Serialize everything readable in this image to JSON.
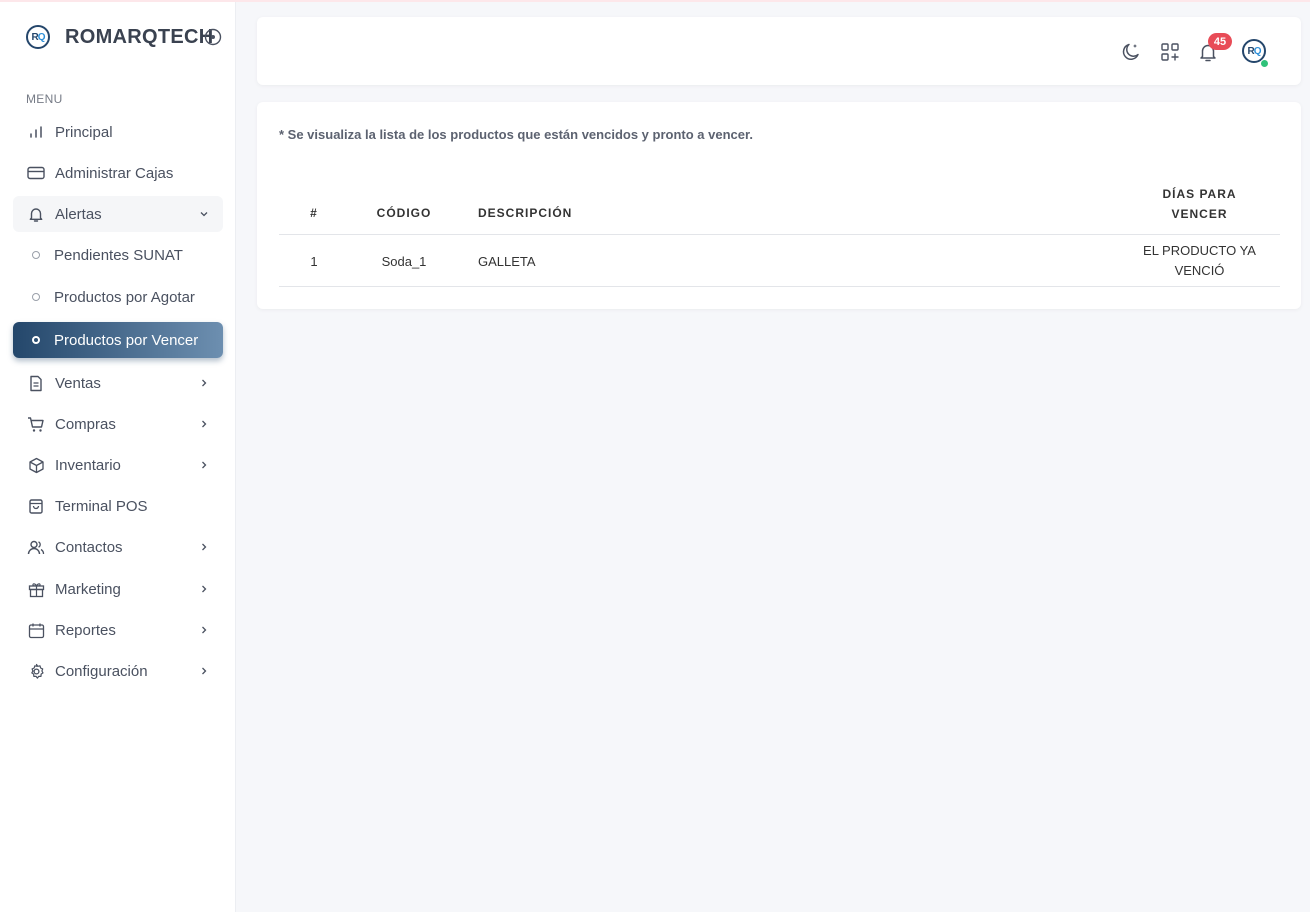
{
  "brand": {
    "name": "ROMARQTECH",
    "logo_letters": [
      "R",
      "Q"
    ]
  },
  "sidebar": {
    "menu_label": "MENU",
    "items": [
      {
        "label": "Principal",
        "icon": "bar-chart-icon"
      },
      {
        "label": "Administrar Cajas",
        "icon": "credit-card-icon"
      },
      {
        "label": "Alertas",
        "icon": "bell-icon",
        "expanded": true,
        "children": [
          {
            "label": "Pendientes SUNAT"
          },
          {
            "label": "Productos por Agotar"
          },
          {
            "label": "Productos por Vencer",
            "active": true
          }
        ]
      },
      {
        "label": "Ventas",
        "icon": "document-icon",
        "has_children": true
      },
      {
        "label": "Compras",
        "icon": "cart-icon",
        "has_children": true
      },
      {
        "label": "Inventario",
        "icon": "box-icon",
        "has_children": true
      },
      {
        "label": "Terminal POS",
        "icon": "shopping-bag-icon"
      },
      {
        "label": "Contactos",
        "icon": "users-icon",
        "has_children": true
      },
      {
        "label": "Marketing",
        "icon": "gift-icon",
        "has_children": true
      },
      {
        "label": "Reportes",
        "icon": "calendar-icon",
        "has_children": true
      },
      {
        "label": "Configuración",
        "icon": "settings-icon",
        "has_children": true
      }
    ]
  },
  "header": {
    "icons": [
      "moon-icon",
      "apps-add-icon",
      "bell-icon",
      "avatar"
    ],
    "notification_count": "45",
    "avatar_letters": [
      "R",
      "Q"
    ],
    "user_status": "online"
  },
  "main": {
    "note": "* Se visualiza la lista de los productos que están vencidos y pronto a vencer.",
    "table": {
      "columns": [
        "#",
        "CÓDIGO",
        "DESCRIPCIÓN",
        "DÍAS PARA VENCER"
      ],
      "rows": [
        {
          "num": "1",
          "codigo": "Soda_1",
          "descripcion": "GALLETA",
          "dias": "EL PRODUCTO YA VENCIÓ"
        }
      ]
    }
  },
  "colors": {
    "active_gradient_start": "#24476b",
    "active_gradient_end": "#6d8fb0",
    "badge": "#e84c57",
    "online": "#2fc27a",
    "background": "#f6f7fa"
  }
}
